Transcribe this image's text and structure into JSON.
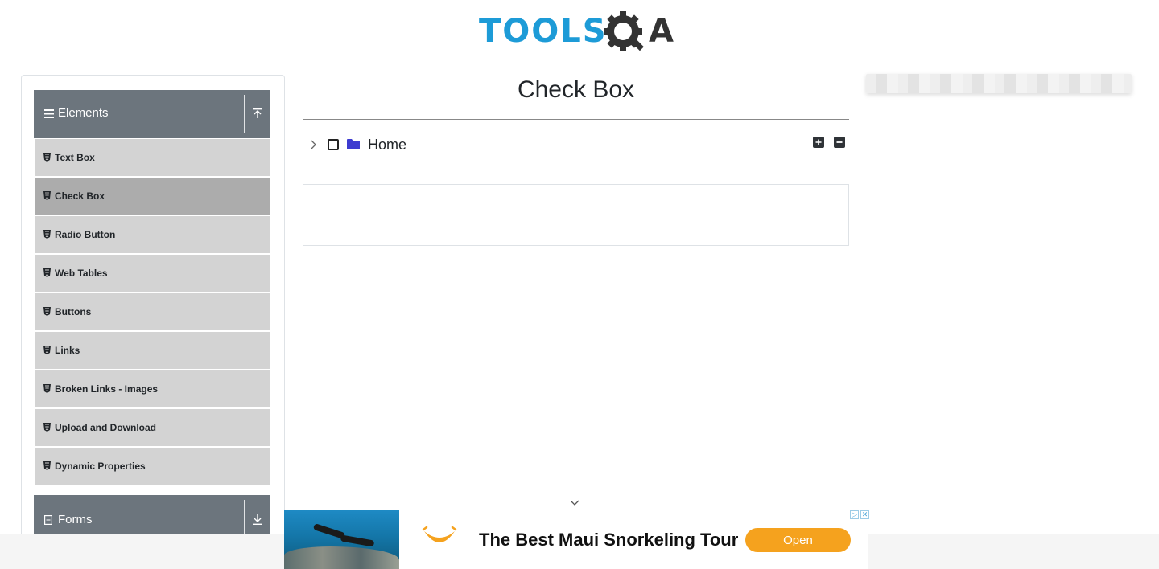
{
  "logo": {
    "text": "TOOLS",
    "suffix": "A"
  },
  "sidebar": {
    "elements_group": {
      "label": "Elements"
    },
    "items": [
      {
        "label": "Text Box"
      },
      {
        "label": "Check Box"
      },
      {
        "label": "Radio Button"
      },
      {
        "label": "Web Tables"
      },
      {
        "label": "Buttons"
      },
      {
        "label": "Links"
      },
      {
        "label": "Broken Links - Images"
      },
      {
        "label": "Upload and Download"
      },
      {
        "label": "Dynamic Properties"
      }
    ],
    "active_index": 1,
    "forms_group": {
      "label": "Forms"
    }
  },
  "main": {
    "title": "Check Box",
    "tree": {
      "root_label": "Home",
      "checked": false,
      "expanded": false
    }
  },
  "ad": {
    "headline": "The Best Maui Snorkeling Tour",
    "cta": "Open"
  },
  "colors": {
    "brand_blue": "#1d9bd7",
    "group_header": "#6c757d",
    "menu_item": "#d3d3d3",
    "menu_item_active": "#acacac",
    "folder": "#3d3bd0",
    "ad_cta": "#f5a21e"
  }
}
